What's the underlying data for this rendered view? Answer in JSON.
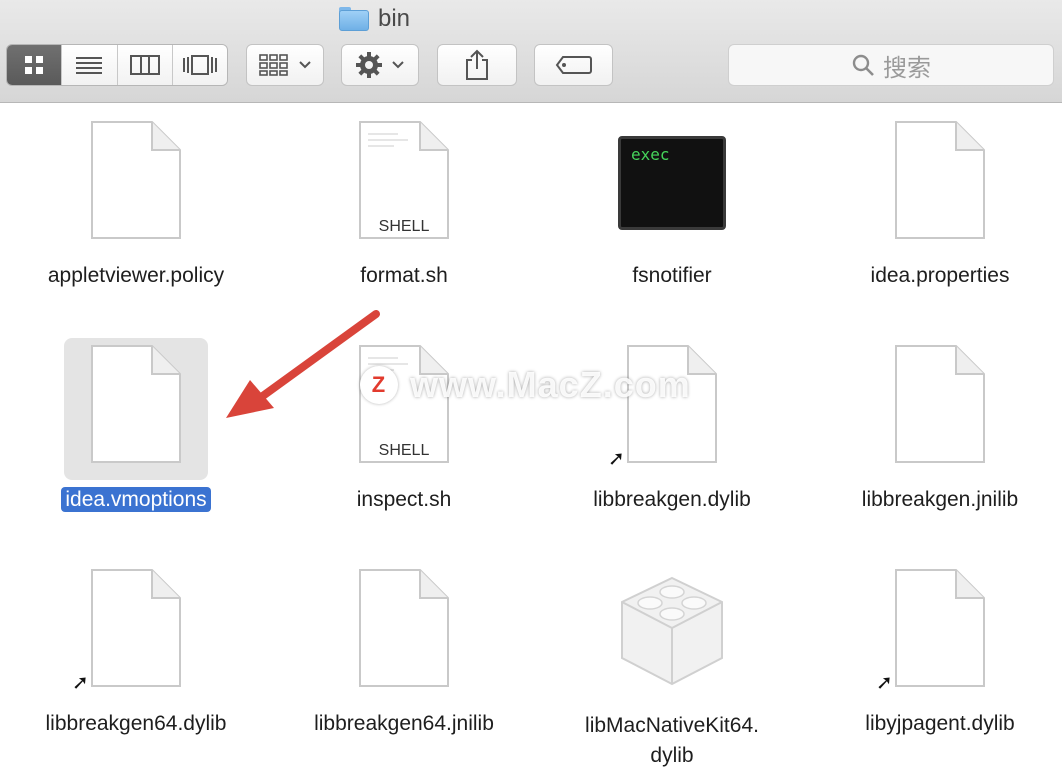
{
  "window": {
    "title": "bin"
  },
  "toolbar": {
    "view_buttons": [
      "icon-view",
      "list-view",
      "column-view",
      "coverflow-view"
    ],
    "active_view": "icon-view",
    "arrange_icon": "arrange-grid-icon",
    "action_icon": "gear-icon",
    "share_icon": "share-icon",
    "tag_icon": "tag-icon",
    "search_placeholder": "搜索"
  },
  "files": [
    {
      "name": "appletviewer.policy",
      "kind": "document"
    },
    {
      "name": "format.sh",
      "kind": "shell",
      "badge": "SHELL"
    },
    {
      "name": "fsnotifier",
      "kind": "exec",
      "badge": "exec"
    },
    {
      "name": "idea.properties",
      "kind": "document"
    },
    {
      "name": "idea.vmoptions",
      "kind": "document",
      "selected": true
    },
    {
      "name": "inspect.sh",
      "kind": "shell",
      "badge": "SHELL"
    },
    {
      "name": "libbreakgen.dylib",
      "kind": "alias"
    },
    {
      "name": "libbreakgen.jnilib",
      "kind": "document"
    },
    {
      "name": "libbreakgen64.dylib",
      "kind": "alias"
    },
    {
      "name": "libbreakgen64.jnilib",
      "kind": "document"
    },
    {
      "name": "libMacNativeKit64.\ndylib",
      "kind": "kext"
    },
    {
      "name": "libyjpagent.dylib",
      "kind": "alias"
    }
  ],
  "watermark": {
    "text": "www.MacZ.com",
    "logo": "Z"
  },
  "colors": {
    "selection": "#3b73d1",
    "exec_text": "#45d45a",
    "arrow": "#d9443a"
  }
}
